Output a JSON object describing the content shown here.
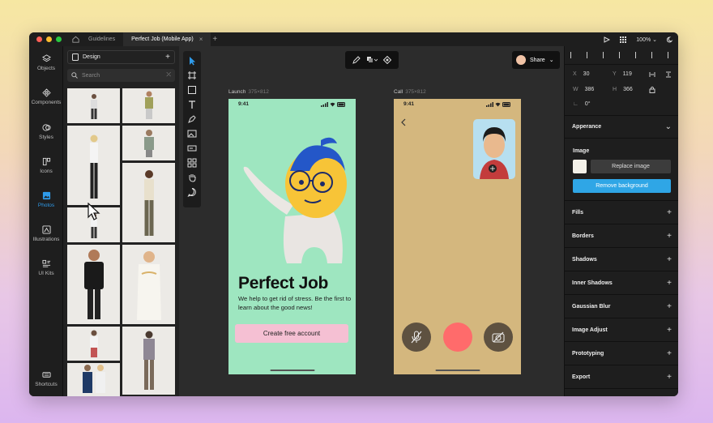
{
  "titlebar": {
    "tabs": [
      {
        "label": "Guidelines",
        "active": false
      },
      {
        "label": "Perfect Job (Mobile App)",
        "active": true
      }
    ],
    "zoom": "100%"
  },
  "nav": {
    "items": [
      {
        "label": "Objects",
        "icon": "layers-icon",
        "active": false
      },
      {
        "label": "Components",
        "icon": "components-icon",
        "active": false
      },
      {
        "label": "Styles",
        "icon": "styles-icon",
        "active": false
      },
      {
        "label": "Icons",
        "icon": "icons-icon",
        "active": false
      },
      {
        "label": "Photos",
        "icon": "photo-icon",
        "active": true
      },
      {
        "label": "Illustrations",
        "icon": "illustration-icon",
        "active": false
      },
      {
        "label": "UI Kits",
        "icon": "ui-kits-icon",
        "active": false
      }
    ],
    "shortcuts_label": "Shortcuts"
  },
  "assets": {
    "library_label": "Design",
    "search_placeholder": "Search"
  },
  "share_label": "Share",
  "frames": {
    "launch": {
      "label": "Launch",
      "dims": "375×812",
      "time": "9:41",
      "headline": "Perfect Job",
      "subtext": "We help to get rid of stress. Be the first to learn about the good news!",
      "cta": "Create free account",
      "bg": "#9ee6c0"
    },
    "call": {
      "label": "Call",
      "dims": "375×812",
      "time": "9:41",
      "bg": "#d4b77e",
      "end_call_color": "#ff6b6b"
    }
  },
  "inspector": {
    "x": "30",
    "y": "119",
    "w": "386",
    "h": "366",
    "rotation": "0°",
    "appearance_label": "Apperance",
    "image_label": "Image",
    "replace_label": "Replace image",
    "remove_label": "Remove background",
    "sections": [
      "Fills",
      "Borders",
      "Shadows",
      "Inner Shadows",
      "Gaussian Blur",
      "Image Adjust",
      "Prototyping",
      "Export"
    ]
  },
  "colors": {
    "accent": "#2f9bea",
    "remove_btn": "#2fa6e6",
    "cta": "#f5c0d3"
  }
}
